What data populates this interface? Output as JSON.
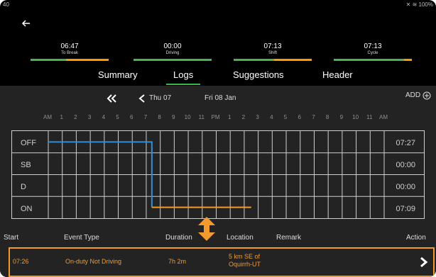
{
  "status_bar": {
    "time": "40",
    "battery": "100%",
    "icons": [
      "mute-icon",
      "wifi-icon",
      "battery-icon"
    ]
  },
  "back": {
    "icon": "back-arrow-icon"
  },
  "counters": [
    {
      "value": "06:47",
      "label": "To Break",
      "progress": 0.55
    },
    {
      "value": "00:00",
      "label": "Driving",
      "progress": 0.0
    },
    {
      "value": "07:13",
      "label": "Shift",
      "progress": 0.48
    },
    {
      "value": "07:13",
      "label": "Cycle",
      "progress": 0.1
    }
  ],
  "tabs": [
    "Summary",
    "Logs",
    "Suggestions",
    "Header"
  ],
  "active_tab": "Logs",
  "nav": {
    "prev_day": "Thu 07",
    "current_day": "Fri 08 Jan",
    "add": "ADD"
  },
  "hours": [
    "AM",
    "1",
    "2",
    "3",
    "4",
    "5",
    "6",
    "7",
    "8",
    "9",
    "10",
    "11",
    "PM",
    "1",
    "2",
    "3",
    "4",
    "5",
    "6",
    "7",
    "8",
    "9",
    "10",
    "11",
    "AM"
  ],
  "rows": [
    {
      "label": "OFF",
      "total": "07:27"
    },
    {
      "label": "SB",
      "total": "00:00"
    },
    {
      "label": "D",
      "total": "00:00"
    },
    {
      "label": "ON",
      "total": "07:09"
    }
  ],
  "table_headers": {
    "start": "Start",
    "event_type": "Event Type",
    "duration": "Duration",
    "location": "Location",
    "remark": "Remark",
    "action": "Action"
  },
  "event": {
    "start": "07:26",
    "type": "On-duty Not Driving",
    "duration": "7h 2m",
    "location_line1": "5 km SE of",
    "location_line2": "Oquirrh-UT"
  },
  "colors": {
    "off_line": "#2f8fd8",
    "on_line": "#f29a2e",
    "accent": "#39b54a",
    "progress_green": "#4caf50",
    "progress_orange": "#ff9800"
  }
}
